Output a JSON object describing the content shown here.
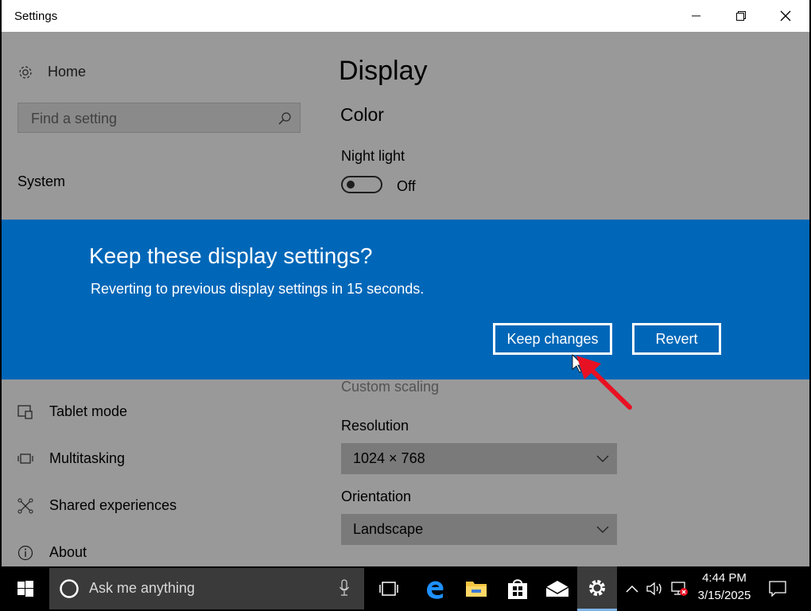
{
  "window": {
    "title": "Settings"
  },
  "sidebar": {
    "home_label": "Home",
    "search_placeholder": "Find a setting",
    "section_label": "System",
    "items": [
      {
        "label": "Tablet mode",
        "icon": "tablet-mode-icon"
      },
      {
        "label": "Multitasking",
        "icon": "multitasking-icon"
      },
      {
        "label": "Shared experiences",
        "icon": "shared-experiences-icon"
      },
      {
        "label": "About",
        "icon": "info-icon"
      }
    ]
  },
  "main": {
    "page_title": "Display",
    "section_title": "Color",
    "night_light_label": "Night light",
    "night_light_state": "Off",
    "custom_scaling_label": "Custom scaling",
    "resolution_label": "Resolution",
    "resolution_value": "1024 × 768",
    "orientation_label": "Orientation",
    "orientation_value": "Landscape"
  },
  "dialog": {
    "title": "Keep these display settings?",
    "message": "Reverting to previous display settings in 15 seconds.",
    "keep_label": "Keep changes",
    "revert_label": "Revert"
  },
  "taskbar": {
    "search_placeholder": "Ask me anything",
    "time": "4:44 PM",
    "date": "3/15/2025"
  },
  "colors": {
    "accent": "#0067b8",
    "annotation_arrow": "#e81123"
  }
}
